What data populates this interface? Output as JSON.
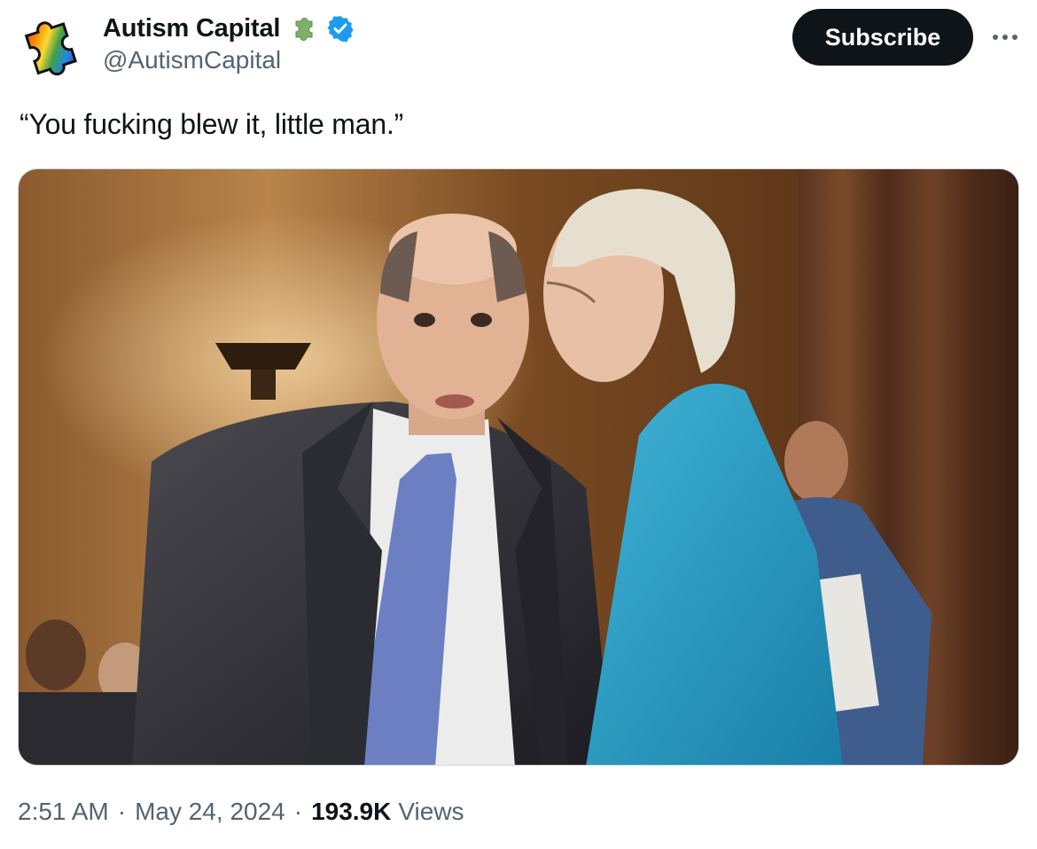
{
  "author": {
    "display_name": "Autism Capital",
    "handle": "@AutismCapital",
    "avatar_icon": "rainbow-puzzle-piece-icon",
    "affiliation_icon": "green-puzzle-piece-icon",
    "verified_icon": "verified-badge-icon"
  },
  "actions": {
    "subscribe_label": "Subscribe",
    "more_icon": "more-options-icon"
  },
  "tweet": {
    "text": "“You fucking blew it, little man.”"
  },
  "media": {
    "type": "photo"
  },
  "meta": {
    "time": "2:51 AM",
    "separator": "·",
    "date": "May 24, 2024",
    "views_count": "193.9K",
    "views_label": "Views"
  },
  "colors": {
    "text_primary": "#0f1419",
    "text_secondary": "#536471",
    "subscribe_bg": "#0f1419",
    "verified_blue": "#1d9bf0",
    "puzzle_green": "#7fb069"
  }
}
